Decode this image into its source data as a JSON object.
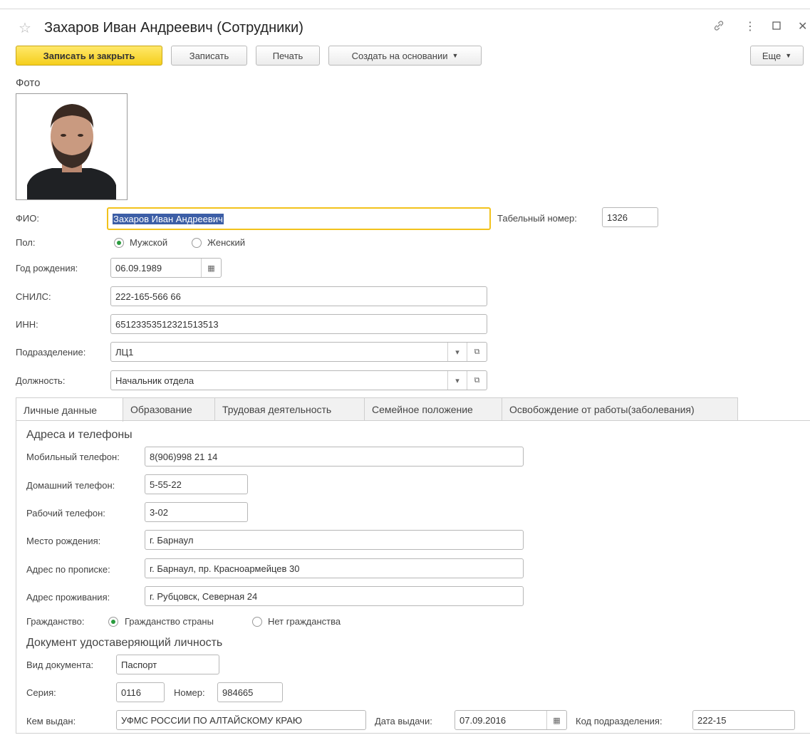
{
  "window": {
    "title": "Захаров Иван Андреевич (Сотрудники)"
  },
  "toolbar": {
    "save_close": "Записать и закрыть",
    "save": "Записать",
    "print": "Печать",
    "create_based": "Создать на основании",
    "more": "Еще"
  },
  "photo": {
    "label": "Фото"
  },
  "form": {
    "fio_label": "ФИО:",
    "fio_value": "Захаров Иван Андреевич",
    "tab_number_label": "Табельный номер:",
    "tab_number_value": "1326",
    "gender_label": "Пол:",
    "gender_male": "Мужской",
    "gender_female": "Женский",
    "birth_label": "Год рождения:",
    "birth_value": "06.09.1989",
    "snils_label": "СНИЛС:",
    "snils_value": "222-165-566 66",
    "inn_label": "ИНН:",
    "inn_value": "65123353512321513513",
    "dept_label": "Подразделение:",
    "dept_value": "ЛЦ1",
    "position_label": "Должность:",
    "position_value": "Начальник отдела"
  },
  "tabs": [
    {
      "label": "Личные данные"
    },
    {
      "label": "Образование"
    },
    {
      "label": "Трудовая деятельность"
    },
    {
      "label": "Семейное положение"
    },
    {
      "label": "Освобождение от работы(заболевания)"
    }
  ],
  "personal": {
    "section_contacts": "Адреса и телефоны",
    "mobile_label": "Мобильный телефон:",
    "mobile_value": "8(906)998 21 14",
    "home_phone_label": "Домашний телефон:",
    "home_phone_value": "5-55-22",
    "work_phone_label": "Рабочий телефон:",
    "work_phone_value": "3-02",
    "birthplace_label": "Место рождения:",
    "birthplace_value": "г. Барнаул",
    "reg_address_label": "Адрес по прописке:",
    "reg_address_value": "г. Барнаул, пр. Красноармейцев 30",
    "live_address_label": "Адрес проживания:",
    "live_address_value": "г. Рубцовск, Северная 24",
    "citizenship_label": "Гражданство:",
    "citizenship_country": "Гражданство страны",
    "citizenship_none": "Нет гражданства",
    "section_document": "Документ удоставеряющий личность",
    "doc_type_label": "Вид документа:",
    "doc_type_value": "Паспорт",
    "series_label": "Серия:",
    "series_value": "0116",
    "number_label": "Номер:",
    "number_value": "984665",
    "issued_by_label": "Кем выдан:",
    "issued_by_value": "УФМС РОССИИ ПО АЛТАЙСКОМУ КРАЮ",
    "issue_date_label": "Дата выдачи:",
    "issue_date_value": "07.09.2016",
    "dept_code_label": "Код подразделения:",
    "dept_code_value": "222-15"
  },
  "colors": {
    "accent_green": "#2a9b3e",
    "primary_button": "#f5cf1c",
    "focus_border": "#f2c21b"
  }
}
